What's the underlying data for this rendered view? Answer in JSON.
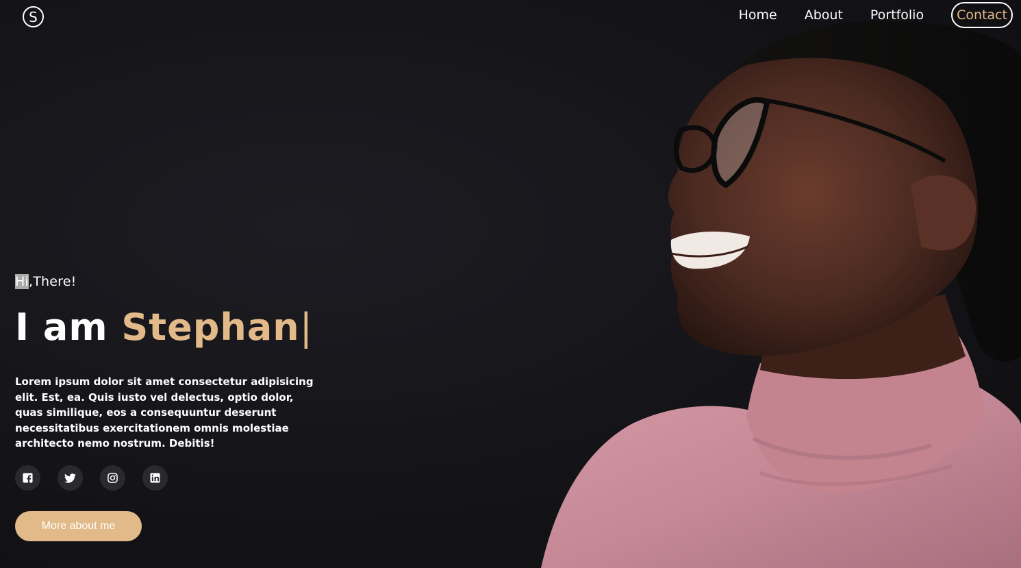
{
  "brand": {
    "logo_letter": "S"
  },
  "nav": {
    "items": [
      {
        "label": "Home"
      },
      {
        "label": "About"
      },
      {
        "label": "Portfolio"
      }
    ],
    "contact_label": "Contact"
  },
  "hero": {
    "greeting_highlight": "Hi",
    "greeting_rest": ",There!",
    "headline_prefix": "I am ",
    "headline_name": "Stephan",
    "caret": "|",
    "bio": "Lorem ipsum dolor sit amet consectetur adipisicing elit. Est, ea. Quis iusto vel delectus, optio dolor, quas similique, eos a consequuntur deserunt necessitatibus exercitationem omnis molestiae architecto nemo nostrum. Debitis!",
    "socials": [
      "facebook-icon",
      "twitter-icon",
      "instagram-icon",
      "linkedin-icon"
    ],
    "cta_label": "More about me"
  },
  "colors": {
    "accent": "#e2b988",
    "background": "#141418",
    "sweater": "#c98f9c",
    "skin": "#5a3327"
  }
}
